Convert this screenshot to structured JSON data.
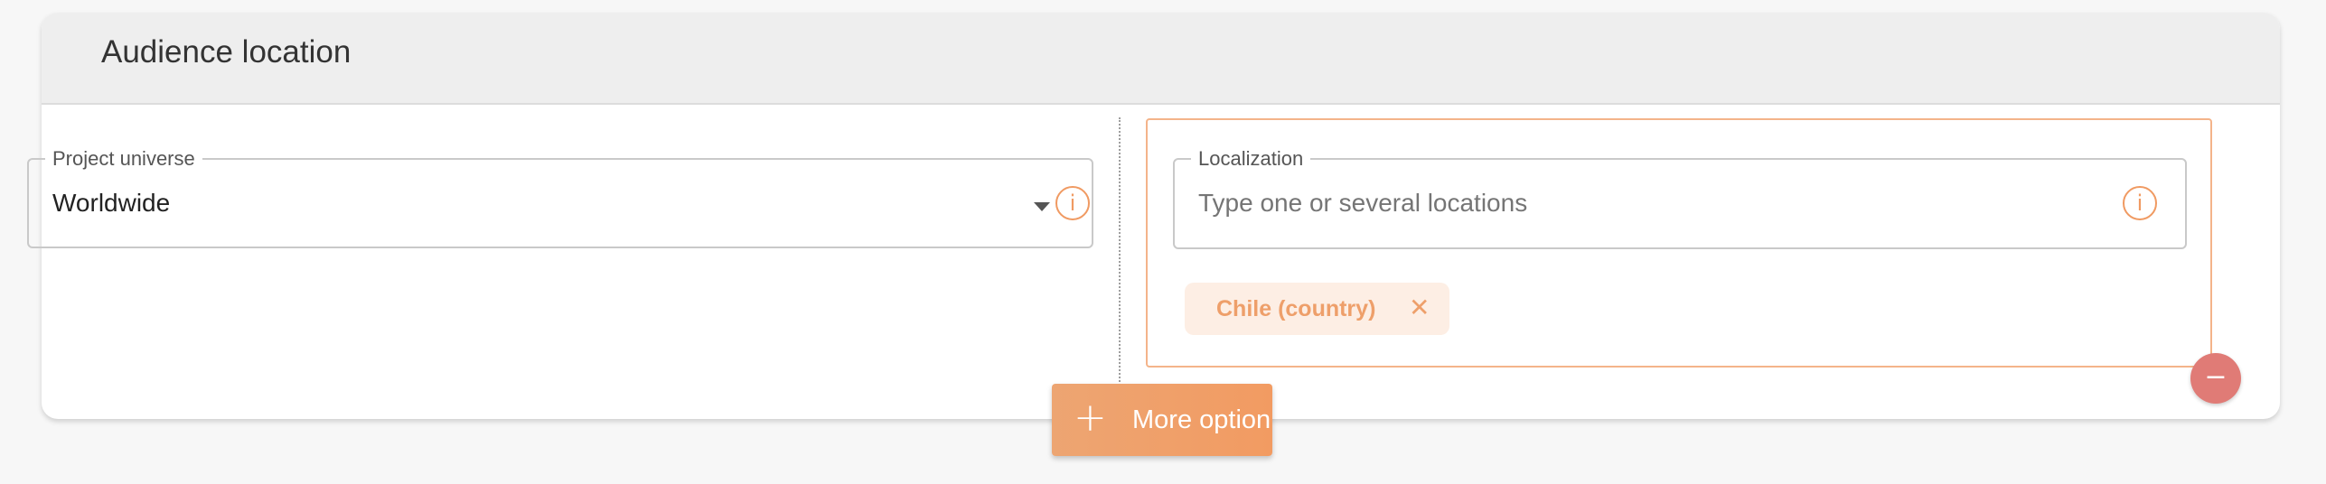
{
  "section": {
    "title": "Audience location"
  },
  "universe": {
    "legend": "Project universe",
    "value": "Worldwide",
    "info_glyph": "i",
    "icon": "info-icon"
  },
  "localization": {
    "legend": "Localization",
    "placeholder": "Type one or several locations",
    "info_glyph": "i",
    "icon": "info-icon"
  },
  "chips": [
    {
      "label": "Chile (country)",
      "remove_glyph": "✕"
    }
  ],
  "remove_button": {
    "glyph": "−",
    "icon": "minus-icon"
  },
  "more_button": {
    "plus": "+",
    "label": "More option",
    "icon": "plus-icon"
  },
  "colors": {
    "accent": "#f09a62",
    "chip_bg": "#fdeee4",
    "remove": "#e07b76",
    "header_bg": "#eeeeee"
  }
}
